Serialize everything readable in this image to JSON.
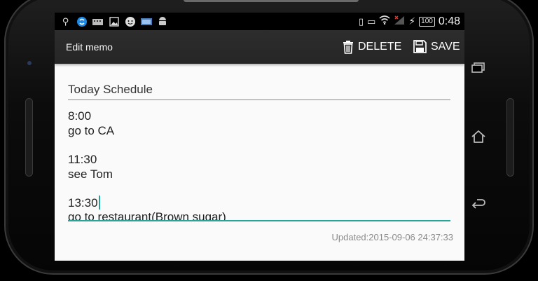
{
  "status_bar": {
    "left_icons": [
      "usb-icon",
      "sync-icon",
      "keyboard-icon",
      "image-icon",
      "chat-icon",
      "storage-icon",
      "android-icon"
    ],
    "right_icons": [
      "vibrate-icon",
      "sim-icon",
      "wifi-icon",
      "signal-icon",
      "charging-icon"
    ],
    "battery": "100",
    "time": "0:48"
  },
  "action_bar": {
    "title": "Edit memo",
    "delete_label": "DELETE",
    "save_label": "SAVE"
  },
  "memo": {
    "subject": "Today Schedule",
    "lines": [
      "8:00",
      "go to CA",
      "",
      "11:30",
      "see Tom",
      "",
      "13:30",
      "go to restaurant(Brown sugar)"
    ],
    "updated": "Updated:2015-09-06 24:37:33"
  },
  "nav": [
    "recent-apps-icon",
    "home-icon",
    "back-icon"
  ],
  "colors": {
    "accent": "#26a69a",
    "action_bar": "#2a2a2a",
    "screen_bg": "#fafafa"
  }
}
